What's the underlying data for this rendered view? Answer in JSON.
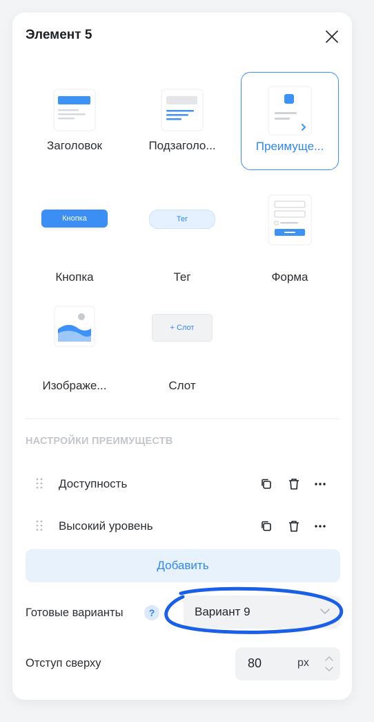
{
  "panel": {
    "title": "Элемент 5"
  },
  "elements": [
    {
      "label": "Заголовок",
      "icon": "heading-block-icon",
      "selected": false
    },
    {
      "label": "Подзаголо...",
      "icon": "subheading-block-icon",
      "selected": false
    },
    {
      "label": "Преимуще...",
      "icon": "advantages-block-icon",
      "selected": true
    },
    {
      "label": "Кнопка",
      "icon": "button-block-icon",
      "thumb_text": "Кнопка",
      "selected": false
    },
    {
      "label": "Тег",
      "icon": "tag-block-icon",
      "thumb_text": "Тег",
      "selected": false
    },
    {
      "label": "Форма",
      "icon": "form-block-icon",
      "selected": false
    },
    {
      "label": "Изображе...",
      "icon": "image-block-icon",
      "selected": false
    },
    {
      "label": "Слот",
      "icon": "slot-block-icon",
      "thumb_text": "+ Слот",
      "selected": false
    }
  ],
  "settings": {
    "section_title": "НАСТРОЙКИ ПРЕИМУЩЕСТВ",
    "items": [
      {
        "label": "Доступность"
      },
      {
        "label": "Высокий уровень"
      }
    ],
    "add_label": "Добавить",
    "presets": {
      "label": "Готовые варианты",
      "help": "?",
      "value": "Вариант 9"
    },
    "top_offset": {
      "label": "Отступ сверху",
      "value": "80",
      "unit": "px"
    }
  },
  "colors": {
    "accent": "#2f86f3",
    "accent_light": "#e8f2fd",
    "annotation": "#1a5fe8"
  }
}
